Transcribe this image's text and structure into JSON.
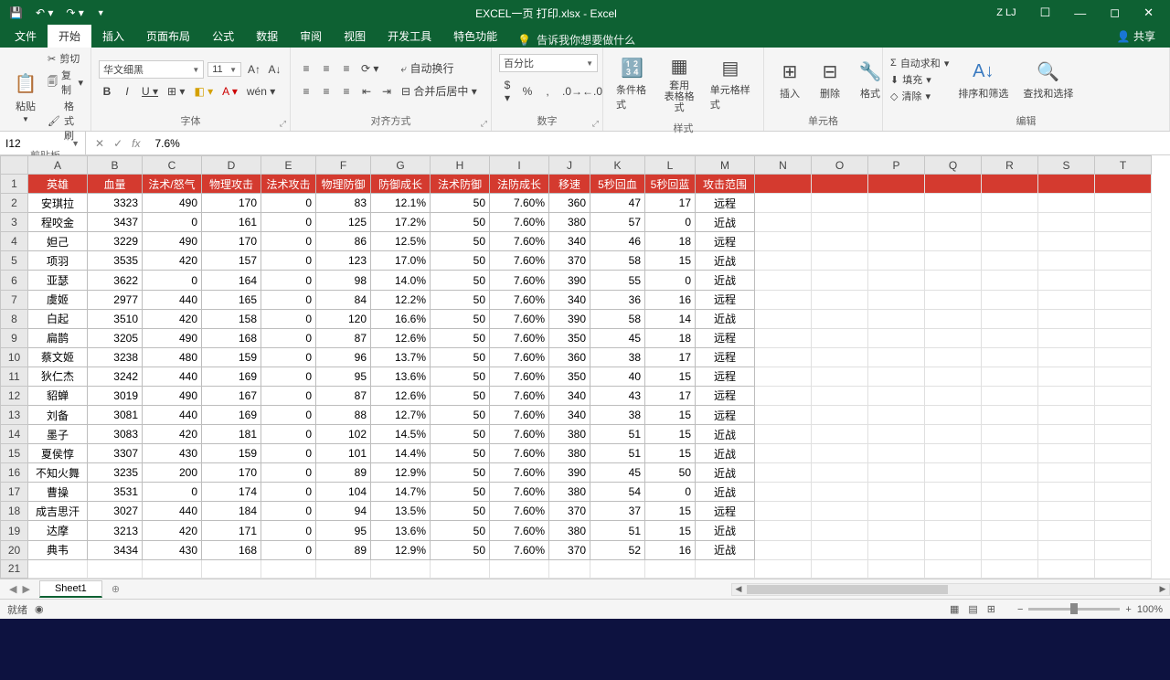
{
  "titlebar": {
    "filename": "EXCEL一页 打印.xlsx - Excel",
    "user": "Z LJ"
  },
  "tabs": {
    "file": "文件",
    "home": "开始",
    "insert": "插入",
    "layout": "页面布局",
    "formula": "公式",
    "data": "数据",
    "review": "审阅",
    "view": "视图",
    "dev": "开发工具",
    "special": "特色功能",
    "tellme": "告诉我你想要做什么",
    "share": "共享"
  },
  "ribbon": {
    "clipboard": {
      "label": "剪贴板",
      "cut": "剪切",
      "copy": "复制",
      "format": "格式刷",
      "paste": "粘贴"
    },
    "font": {
      "label": "字体",
      "name": "华文细黑",
      "size": "11"
    },
    "align": {
      "label": "对齐方式",
      "wrap": "自动换行",
      "merge": "合并后居中"
    },
    "number": {
      "label": "数字",
      "format": "百分比"
    },
    "styles": {
      "label": "样式",
      "cond": "条件格式",
      "tbl": "套用\n表格格式",
      "cell": "单元格样式"
    },
    "cells": {
      "label": "单元格",
      "insert": "插入",
      "delete": "删除",
      "format": "格式"
    },
    "edit": {
      "label": "编辑",
      "sum": "自动求和",
      "fill": "填充",
      "clear": "清除",
      "sort": "排序和筛选",
      "find": "查找和选择"
    }
  },
  "formula": {
    "cell": "I12",
    "value": "7.6%"
  },
  "cols": [
    "A",
    "B",
    "C",
    "D",
    "E",
    "F",
    "G",
    "H",
    "I",
    "J",
    "K",
    "L",
    "M",
    "N",
    "O",
    "P",
    "Q",
    "R",
    "S",
    "T"
  ],
  "header_row": [
    "英雄",
    "血量",
    "法术/怒气",
    "物理攻击",
    "法术攻击",
    "物理防御",
    "防御成长",
    "法术防御",
    "法防成长",
    "移速",
    "5秒回血",
    "5秒回蓝",
    "攻击范围"
  ],
  "rows": [
    [
      "安琪拉",
      "3323",
      "490",
      "170",
      "0",
      "83",
      "12.1%",
      "50",
      "7.60%",
      "360",
      "47",
      "17",
      "远程"
    ],
    [
      "程咬金",
      "3437",
      "0",
      "161",
      "0",
      "125",
      "17.2%",
      "50",
      "7.60%",
      "380",
      "57",
      "0",
      "近战"
    ],
    [
      "妲己",
      "3229",
      "490",
      "170",
      "0",
      "86",
      "12.5%",
      "50",
      "7.60%",
      "340",
      "46",
      "18",
      "远程"
    ],
    [
      "项羽",
      "3535",
      "420",
      "157",
      "0",
      "123",
      "17.0%",
      "50",
      "7.60%",
      "370",
      "58",
      "15",
      "近战"
    ],
    [
      "亚瑟",
      "3622",
      "0",
      "164",
      "0",
      "98",
      "14.0%",
      "50",
      "7.60%",
      "390",
      "55",
      "0",
      "近战"
    ],
    [
      "虞姬",
      "2977",
      "440",
      "165",
      "0",
      "84",
      "12.2%",
      "50",
      "7.60%",
      "340",
      "36",
      "16",
      "远程"
    ],
    [
      "白起",
      "3510",
      "420",
      "158",
      "0",
      "120",
      "16.6%",
      "50",
      "7.60%",
      "390",
      "58",
      "14",
      "近战"
    ],
    [
      "扁鹊",
      "3205",
      "490",
      "168",
      "0",
      "87",
      "12.6%",
      "50",
      "7.60%",
      "350",
      "45",
      "18",
      "远程"
    ],
    [
      "蔡文姬",
      "3238",
      "480",
      "159",
      "0",
      "96",
      "13.7%",
      "50",
      "7.60%",
      "360",
      "38",
      "17",
      "远程"
    ],
    [
      "狄仁杰",
      "3242",
      "440",
      "169",
      "0",
      "95",
      "13.6%",
      "50",
      "7.60%",
      "350",
      "40",
      "15",
      "远程"
    ],
    [
      "貂蝉",
      "3019",
      "490",
      "167",
      "0",
      "87",
      "12.6%",
      "50",
      "7.60%",
      "340",
      "43",
      "17",
      "远程"
    ],
    [
      "刘备",
      "3081",
      "440",
      "169",
      "0",
      "88",
      "12.7%",
      "50",
      "7.60%",
      "340",
      "38",
      "15",
      "远程"
    ],
    [
      "墨子",
      "3083",
      "420",
      "181",
      "0",
      "102",
      "14.5%",
      "50",
      "7.60%",
      "380",
      "51",
      "15",
      "近战"
    ],
    [
      "夏侯惇",
      "3307",
      "430",
      "159",
      "0",
      "101",
      "14.4%",
      "50",
      "7.60%",
      "380",
      "51",
      "15",
      "近战"
    ],
    [
      "不知火舞",
      "3235",
      "200",
      "170",
      "0",
      "89",
      "12.9%",
      "50",
      "7.60%",
      "390",
      "45",
      "50",
      "近战"
    ],
    [
      "曹操",
      "3531",
      "0",
      "174",
      "0",
      "104",
      "14.7%",
      "50",
      "7.60%",
      "380",
      "54",
      "0",
      "近战"
    ],
    [
      "成吉思汗",
      "3027",
      "440",
      "184",
      "0",
      "94",
      "13.5%",
      "50",
      "7.60%",
      "370",
      "37",
      "15",
      "远程"
    ],
    [
      "达摩",
      "3213",
      "420",
      "171",
      "0",
      "95",
      "13.6%",
      "50",
      "7.60%",
      "380",
      "51",
      "15",
      "近战"
    ],
    [
      "典韦",
      "3434",
      "430",
      "168",
      "0",
      "89",
      "12.9%",
      "50",
      "7.60%",
      "370",
      "52",
      "16",
      "近战"
    ]
  ],
  "sheet": {
    "name": "Sheet1"
  },
  "status": {
    "ready": "就绪",
    "zoom": "100%"
  }
}
